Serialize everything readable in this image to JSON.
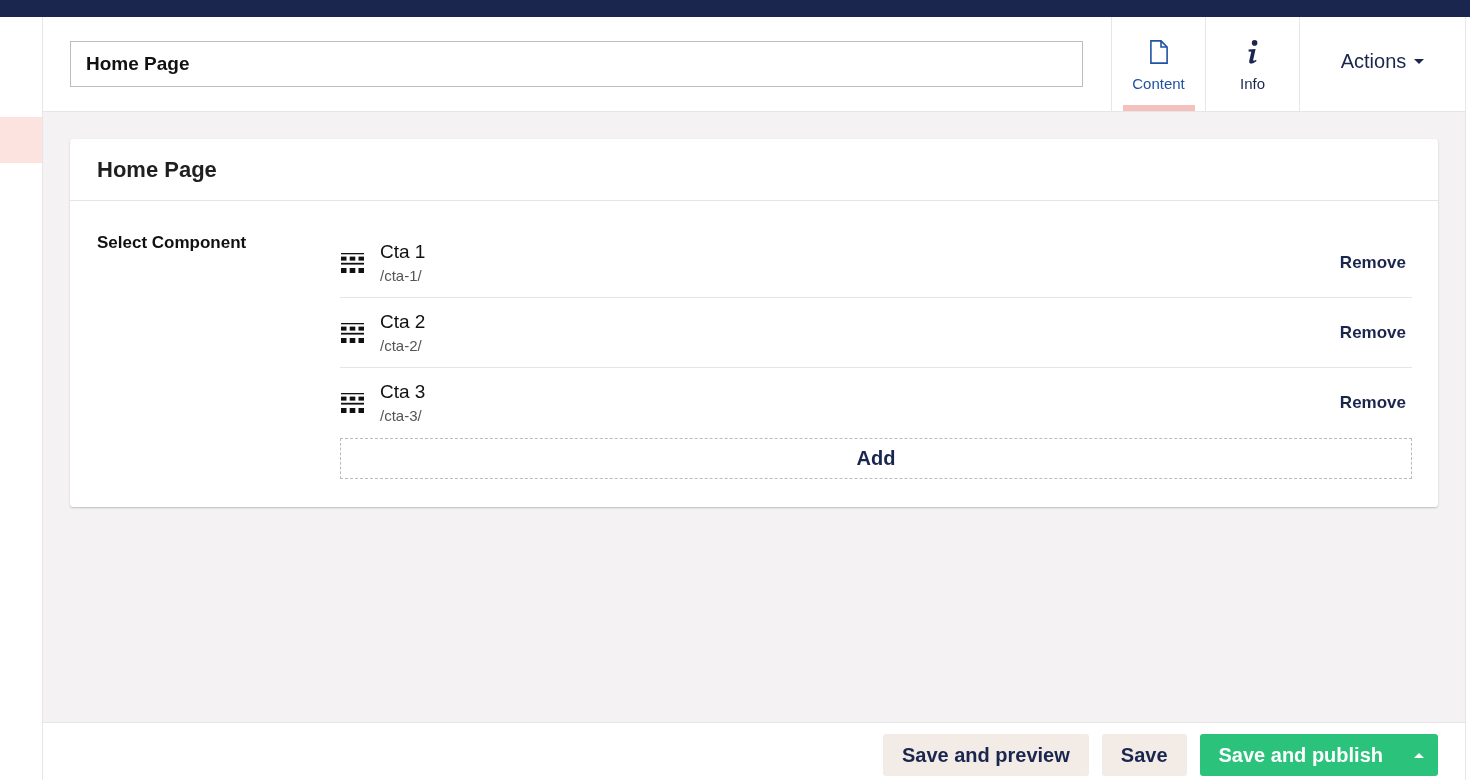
{
  "sidebar": {
    "items": [
      {
        "selected": true
      }
    ]
  },
  "header": {
    "name_field": {
      "value": "Home Page"
    },
    "tabs": [
      {
        "label": "Content",
        "kind": "document",
        "selected": true
      },
      {
        "label": "Info",
        "kind": "info",
        "selected": false
      }
    ],
    "actions": {
      "label": "Actions"
    }
  },
  "card": {
    "title": "Home Page",
    "property": {
      "label": "Select Component",
      "items": [
        {
          "name": "Cta 1",
          "path": "/cta-1/",
          "action": "Remove"
        },
        {
          "name": "Cta 2",
          "path": "/cta-2/",
          "action": "Remove"
        },
        {
          "name": "Cta 3",
          "path": "/cta-3/",
          "action": "Remove"
        }
      ],
      "add_button": "Add"
    }
  },
  "footer": {
    "buttons": [
      {
        "label": "Save and preview",
        "kind": "secondary",
        "menu": false
      },
      {
        "label": "Save",
        "kind": "secondary",
        "menu": false
      },
      {
        "label": "Save and publish",
        "kind": "primary",
        "menu": true
      }
    ]
  }
}
